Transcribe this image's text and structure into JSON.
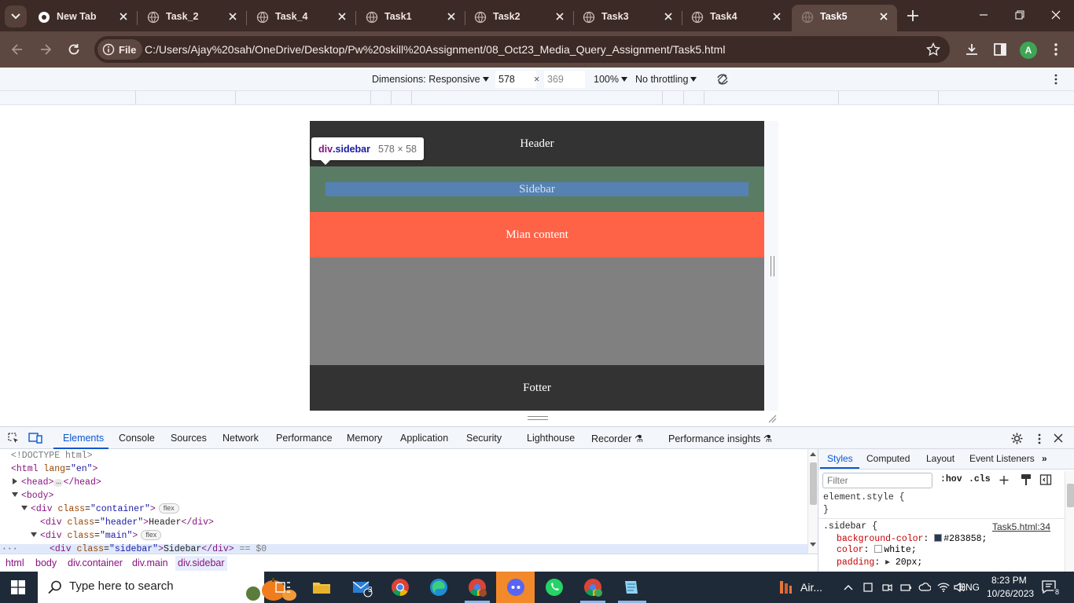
{
  "browser": {
    "tabs": [
      {
        "title": "New Tab",
        "icon": "chrome-icon"
      },
      {
        "title": "Task_2",
        "icon": "globe-icon"
      },
      {
        "title": "Task_4",
        "icon": "globe-icon"
      },
      {
        "title": "Task1",
        "icon": "globe-icon"
      },
      {
        "title": "Task2",
        "icon": "globe-icon"
      },
      {
        "title": "Task3",
        "icon": "globe-icon"
      },
      {
        "title": "Task4",
        "icon": "globe-icon"
      },
      {
        "title": "Task5",
        "icon": "globe-icon",
        "active": true
      }
    ],
    "address": {
      "chip_label": "File",
      "url": "C:/Users/Ajay%20sah/OneDrive/Desktop/Pw%20skill%20Assignment/08_Oct23_Media_Query_Assignment/Task5.html"
    },
    "profile_initial": "A"
  },
  "device_toolbar": {
    "dimensions_label": "Dimensions: Responsive",
    "width": "578",
    "times": "×",
    "height": "369",
    "zoom": "100%",
    "throttling": "No throttling"
  },
  "page": {
    "header": "Header",
    "sidebar": "Sidebar",
    "main": "Mian content",
    "footer": "Fotter",
    "inspect_tooltip": {
      "selector_tag": "div",
      "selector_class": ".sidebar",
      "size": "578 × 58"
    }
  },
  "devtools": {
    "tabs": [
      "Elements",
      "Console",
      "Sources",
      "Network",
      "Performance",
      "Memory",
      "Application",
      "Security",
      "Lighthouse",
      "Recorder",
      "Performance insights"
    ],
    "active_tab": "Elements",
    "dom": {
      "doctype": "<!DOCTYPE html>",
      "html_open": "<html",
      "lang_attr": "lang",
      "lang_val": "\"en\"",
      "head": "<head>",
      "head_close": "</head>",
      "body": "<body>",
      "container_open": "<div",
      "class_attr": "class",
      "container_val": "\"container\"",
      "header_val": "\"header\"",
      "header_text": "Header",
      "div_close": "</div>",
      "main_val": "\"main\"",
      "sidebar_val": "\"sidebar\"",
      "sidebar_text": "Sidebar",
      "selected_marker": "== $0",
      "badge": "flex",
      "ellipsis": "…"
    },
    "breadcrumbs": [
      "html",
      "body",
      "div.container",
      "div.main",
      "div.sidebar"
    ],
    "styles": {
      "tabs": [
        "Styles",
        "Computed",
        "Layout",
        "Event Listeners"
      ],
      "filter_placeholder": "Filter",
      "hov": ":hov",
      "cls": ".cls",
      "element_style": "element.style {",
      "brace_close": "}",
      "rule_selector": ".sidebar {",
      "rule_source": "Task5.html:34",
      "props": [
        {
          "name": "background-color",
          "value": "#283858;"
        },
        {
          "name": "color",
          "value": "white;"
        },
        {
          "name": "padding",
          "value": "20px;"
        }
      ],
      "swatch_colors": [
        "#283858",
        "#ffffff"
      ]
    }
  },
  "taskbar": {
    "search_placeholder": "Type here to search",
    "mail_badge": "3",
    "weather": "Air...",
    "language": "ENG",
    "time": "8:23 PM",
    "date": "10/26/2023",
    "notifications": "8"
  },
  "colors": {
    "tab_strip": "#3c2a26",
    "toolbar": "#5d4741",
    "page_header": "#333333",
    "page_sidebar_bg": "#5b7c64",
    "page_main": "#ff6347",
    "page_gray": "#808080",
    "devtools_accent": "#0b57d0"
  }
}
